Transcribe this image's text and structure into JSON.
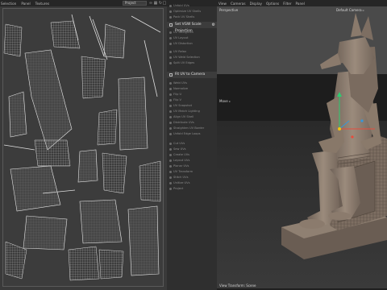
{
  "uv_editor": {
    "menu": [
      "Selection",
      "Panel",
      "Textures"
    ],
    "project_select": "Project",
    "tool_icons": [
      "link-icon",
      "grid-icon",
      "refresh-icon",
      "maximize-icon"
    ]
  },
  "palette": {
    "group1": [
      "Unfold UVs",
      "Optimize UV Shells",
      "Pack UV Shells"
    ],
    "project_header": "Set VGW Scale Projection",
    "group2": [
      "UV Straighten",
      "UV Layout",
      "UV Distortion"
    ],
    "group3": [
      "UV Relax",
      "UV Weld Selection",
      "Split UV Edges"
    ],
    "camera_header": "Fit UV to Camera",
    "group4": [
      "Weld UVs",
      "Normalize",
      "Flip U",
      "Flip V",
      "UV Snapshot",
      "UV Match Lighting",
      "Align UV Shell",
      "Distribute UVs",
      "Straighten UV Border",
      "Unfold Edge Loops"
    ],
    "group5": [
      "Cut UVs",
      "Sew UVs",
      "Create UVs",
      "Layout UVs",
      "Planar UVs",
      "UV Transform",
      "Stitch UVs",
      "Unitize UVs",
      "Project"
    ]
  },
  "viewport": {
    "menu": [
      "View",
      "Cameras",
      "Display",
      "Options",
      "Filter",
      "Panel"
    ],
    "perspective_label": "Perspective",
    "camera_label": "Default Camera ▹",
    "move_label": "Move ▹",
    "status_label": "View Transform: Scene",
    "colors": {
      "statue": "#8a7a6c",
      "gizmo_y": "#2ecc71",
      "gizmo_x": "#e74c3c",
      "gizmo_z": "#3498db"
    }
  }
}
